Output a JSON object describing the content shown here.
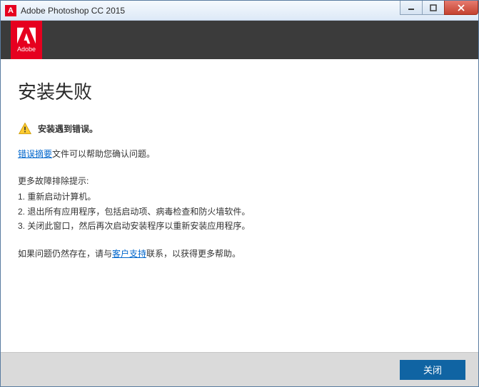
{
  "titlebar": {
    "app_title": "Adobe Photoshop CC 2015",
    "icon_letter": "A"
  },
  "adobe_logo_text": "Adobe",
  "content": {
    "heading": "安装失败",
    "warn_text": "安装遇到错误。",
    "summary_link_label": "错误摘要",
    "summary_rest": "文件可以帮助您确认问题。",
    "tips_heading": "更多故障排除提示:",
    "tips": [
      "1. 重新启动计算机。",
      "2. 退出所有应用程序，包括启动项、病毒检查和防火墙软件。",
      "3. 关闭此窗口，然后再次启动安装程序以重新安装应用程序。"
    ],
    "persist_prefix": "如果问题仍然存在，请与",
    "persist_link": "客户支持",
    "persist_suffix": "联系，以获得更多帮助。"
  },
  "footer": {
    "close_label": "关闭"
  }
}
